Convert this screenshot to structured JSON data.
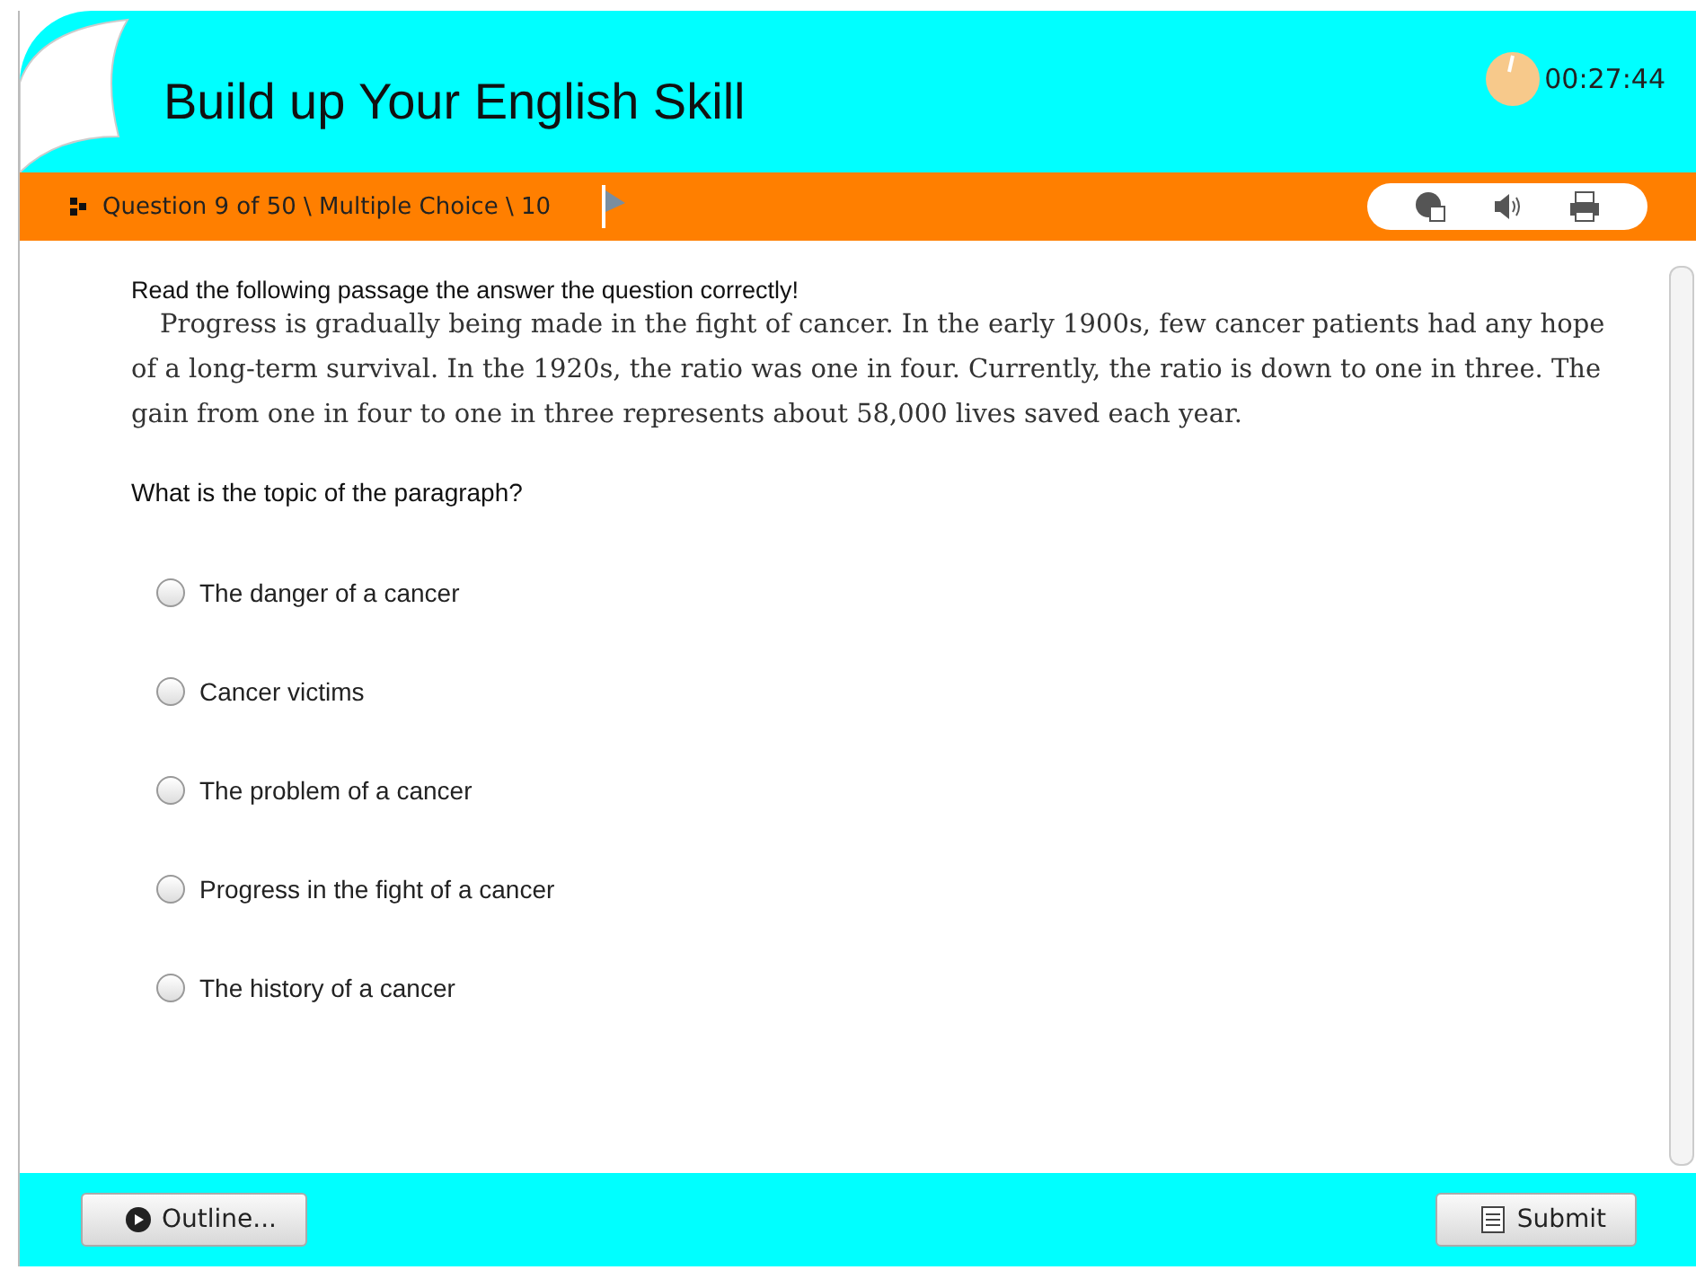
{
  "header": {
    "title": "Build up Your English Skill",
    "timer": "00:27:44"
  },
  "question_bar": {
    "label": "Question 9 of 50 \\ Multiple Choice \\ 10"
  },
  "content": {
    "instruction": "Read the following passage the answer the question correctly!",
    "passage": "Progress is gradually being made in the fight of cancer. In the early 1900s, few cancer patients had any hope of a long-term survival. In the 1920s, the ratio was one in four. Currently, the ratio is down to one in three. The gain from one in four to one in three represents about 58,000 lives saved each year.",
    "question": "What is the topic of the paragraph?",
    "options": [
      {
        "label": "The danger of a cancer",
        "selected": false
      },
      {
        "label": "Cancer victims",
        "selected": false
      },
      {
        "label": "The problem of a cancer",
        "selected": false
      },
      {
        "label": "Progress in the fight of a cancer",
        "selected": false
      },
      {
        "label": "The history of a cancer",
        "selected": false
      }
    ]
  },
  "footer": {
    "outline_button": "Outline...",
    "submit_button": "Submit"
  }
}
